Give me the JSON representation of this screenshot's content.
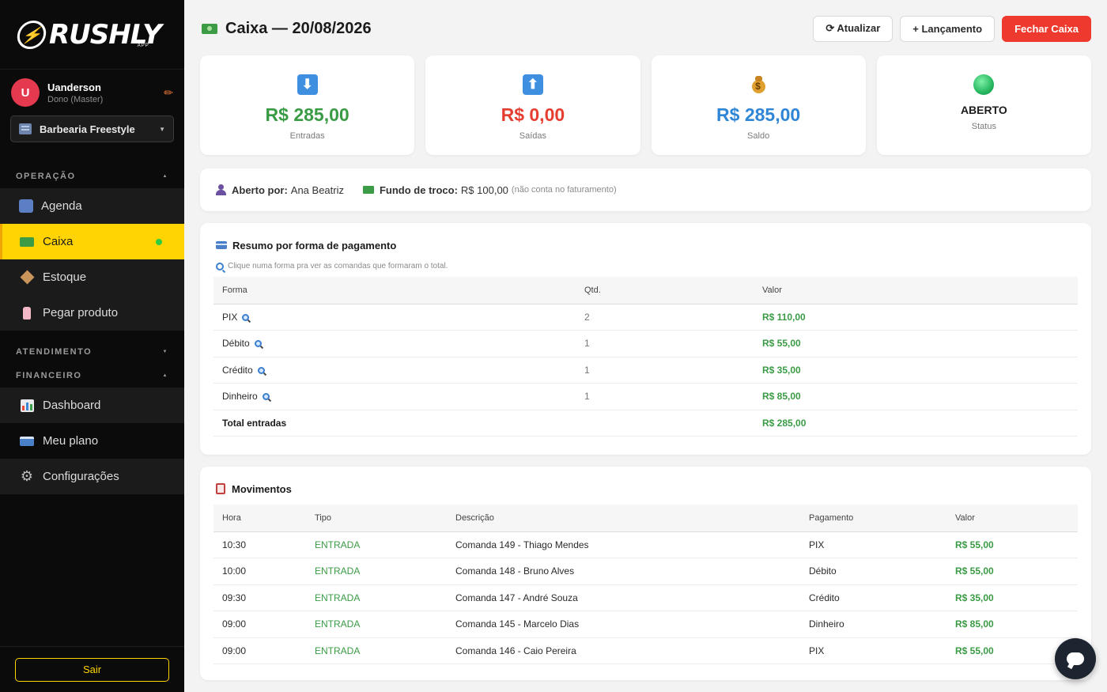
{
  "brand": {
    "name": "RUSHLY",
    "sub": "APP",
    "badge_icon": "bolt-icon"
  },
  "user": {
    "initial": "U",
    "name": "Uanderson",
    "role": "Dono (Master)",
    "avatar_color": "#e53950"
  },
  "shop": {
    "selected": "Barbearia Freestyle"
  },
  "sidebar": {
    "sections": [
      {
        "label": "OPERAÇÃO"
      },
      {
        "label": "ATENDIMENTO"
      },
      {
        "label": "FINANCEIRO"
      }
    ],
    "operacao_items": [
      {
        "label": "Agenda",
        "icon": "calendar-icon"
      },
      {
        "label": "Caixa",
        "icon": "cash-icon",
        "active": true
      },
      {
        "label": "Estoque",
        "icon": "box-icon"
      },
      {
        "label": "Pegar produto",
        "icon": "bottle-icon"
      }
    ],
    "financeiro_items": [
      {
        "label": "Dashboard",
        "icon": "bar-chart-icon"
      },
      {
        "label": "Meu plano",
        "icon": "credit-card-icon"
      },
      {
        "label": "Configurações",
        "icon": "gear-icon"
      }
    ],
    "logout_label": "Sair"
  },
  "header": {
    "title": "Caixa — 20/08/2026",
    "refresh_label": "⟳ Atualizar",
    "add_label": "+ Lançamento",
    "close_label": "Fechar Caixa"
  },
  "cards": [
    {
      "value": "R$ 285,00",
      "label": "Entradas",
      "color": "#3a9b45"
    },
    {
      "value": "R$ 0,00",
      "label": "Saídas",
      "color": "#e53e30"
    },
    {
      "value": "R$ 285,00",
      "label": "Saldo",
      "color": "#2f86d6"
    },
    {
      "value": "ABERTO",
      "label": "Status",
      "color": "#27b860"
    }
  ],
  "info": {
    "opened_by_label": "Aberto por:",
    "opened_by": "Ana Beatriz",
    "change_fund_label": "Fundo de troco:",
    "change_fund": "R$ 100,00",
    "change_fund_note": "(não conta no faturamento)"
  },
  "summary": {
    "title": "Resumo por forma de pagamento",
    "hint": "Clique numa forma pra ver as comandas que formaram o total.",
    "columns": [
      "Forma",
      "Qtd.",
      "Valor"
    ],
    "rows": [
      {
        "forma": "PIX",
        "qtd": "2",
        "valor": "R$ 110,00"
      },
      {
        "forma": "Débito",
        "qtd": "1",
        "valor": "R$ 55,00"
      },
      {
        "forma": "Crédito",
        "qtd": "1",
        "valor": "R$ 35,00"
      },
      {
        "forma": "Dinheiro",
        "qtd": "1",
        "valor": "R$ 85,00"
      }
    ],
    "total_label": "Total entradas",
    "total_value": "R$ 285,00"
  },
  "movements": {
    "title": "Movimentos",
    "columns": [
      "Hora",
      "Tipo",
      "Descrição",
      "Pagamento",
      "Valor"
    ],
    "rows": [
      {
        "hora": "10:30",
        "tipo": "ENTRADA",
        "descricao": "Comanda 149 - Thiago Mendes",
        "pagamento": "PIX",
        "valor": "R$ 55,00"
      },
      {
        "hora": "10:00",
        "tipo": "ENTRADA",
        "descricao": "Comanda 148 - Bruno Alves",
        "pagamento": "Débito",
        "valor": "R$ 55,00"
      },
      {
        "hora": "09:30",
        "tipo": "ENTRADA",
        "descricao": "Comanda 147 - André Souza",
        "pagamento": "Crédito",
        "valor": "R$ 35,00"
      },
      {
        "hora": "09:00",
        "tipo": "ENTRADA",
        "descricao": "Comanda 145 - Marcelo Dias",
        "pagamento": "Dinheiro",
        "valor": "R$ 85,00"
      },
      {
        "hora": "09:00",
        "tipo": "ENTRADA",
        "descricao": "Comanda 146 - Caio Pereira",
        "pagamento": "PIX",
        "valor": "R$ 55,00"
      }
    ]
  },
  "chat": {
    "icon": "chat-bubble-icon"
  }
}
